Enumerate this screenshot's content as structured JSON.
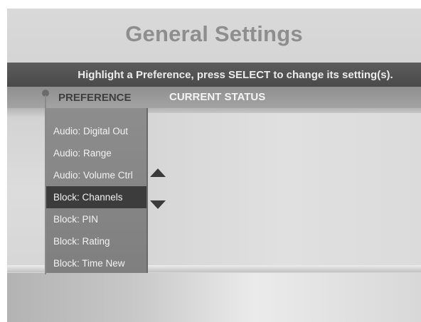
{
  "screen": {
    "title": "General Settings",
    "instruction": "Highlight a Preference, press SELECT to change its setting(s)."
  },
  "columns": {
    "preference": "PREFERENCE",
    "current_status": "CURRENT STATUS"
  },
  "preferences": {
    "selected_index": 3,
    "items": [
      {
        "label": "Audio: Digital Out"
      },
      {
        "label": "Audio: Range"
      },
      {
        "label": "Audio: Volume Ctrl"
      },
      {
        "label": "Block: Channels"
      },
      {
        "label": "Block: PIN"
      },
      {
        "label": "Block: Rating"
      },
      {
        "label": "Block: Time New"
      }
    ]
  },
  "icons": {
    "scroll_up": "triangle-up-icon",
    "scroll_down": "triangle-down-icon"
  },
  "colors": {
    "selection": "#3c3c3c",
    "instruction_bar": "#4f4f4f",
    "title_text": "#8e8e8e"
  }
}
